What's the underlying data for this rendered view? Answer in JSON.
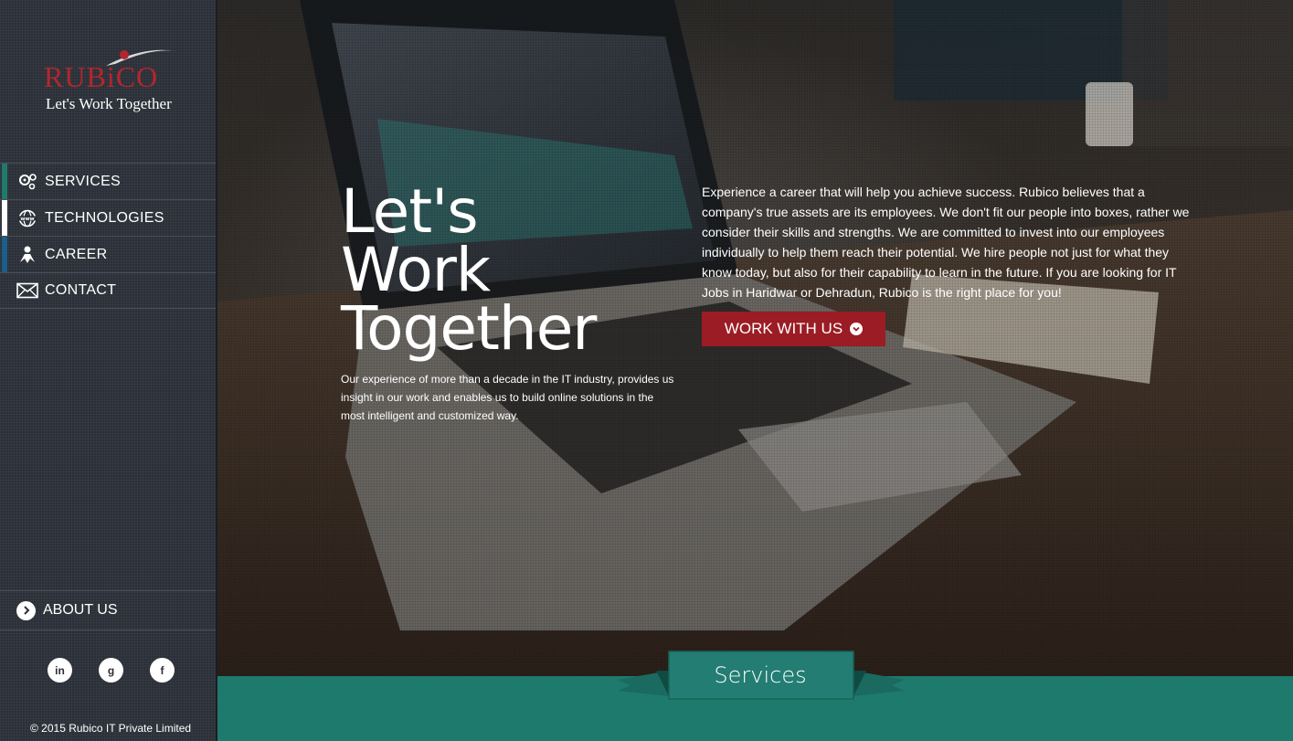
{
  "brand": {
    "logo_text": "RUBiCO",
    "tagline": "Let's Work Together"
  },
  "nav": {
    "items": [
      {
        "label": "SERVICES",
        "icon": "gears-icon",
        "accent": "#1f7a6e"
      },
      {
        "label": "TECHNOLOGIES",
        "icon": "www-globe-icon",
        "accent": "#ffffff"
      },
      {
        "label": "CAREER",
        "icon": "person-icon",
        "accent": "#1c5d8a"
      },
      {
        "label": "CONTACT",
        "icon": "envelope-icon",
        "accent": ""
      }
    ],
    "about_label": "ABOUT US"
  },
  "social": {
    "linkedin": "in",
    "google": "g",
    "facebook": "f"
  },
  "footer": {
    "copyright": "© 2015 Rubico IT Private Limited"
  },
  "hero": {
    "headline": [
      "Let's",
      "Work",
      "Together"
    ],
    "subcopy": "Our experience of more than a decade in the IT industry, provides us insight in our work and enables us to build online solutions in the most intelligent and customized way.",
    "career_copy": "Experience a career that will help you achieve success. Rubico believes that a company's true assets are its employees. We don't fit our people into boxes, rather we consider their skills and strengths. We are committed to invest into our employees individually to help them reach their potential. We hire people not just for what they know today, but also for their capability to learn in the future. If you are looking for IT Jobs in Haridwar or Dehradun, Rubico is the right place for you!",
    "cta_label": "WORK WITH US"
  },
  "section": {
    "ribbon_label": "Services"
  },
  "colors": {
    "brand_red": "#b3262d",
    "cta_red": "#9b1c24",
    "teal": "#1f7a6e",
    "sidebar": "#2b3038"
  }
}
